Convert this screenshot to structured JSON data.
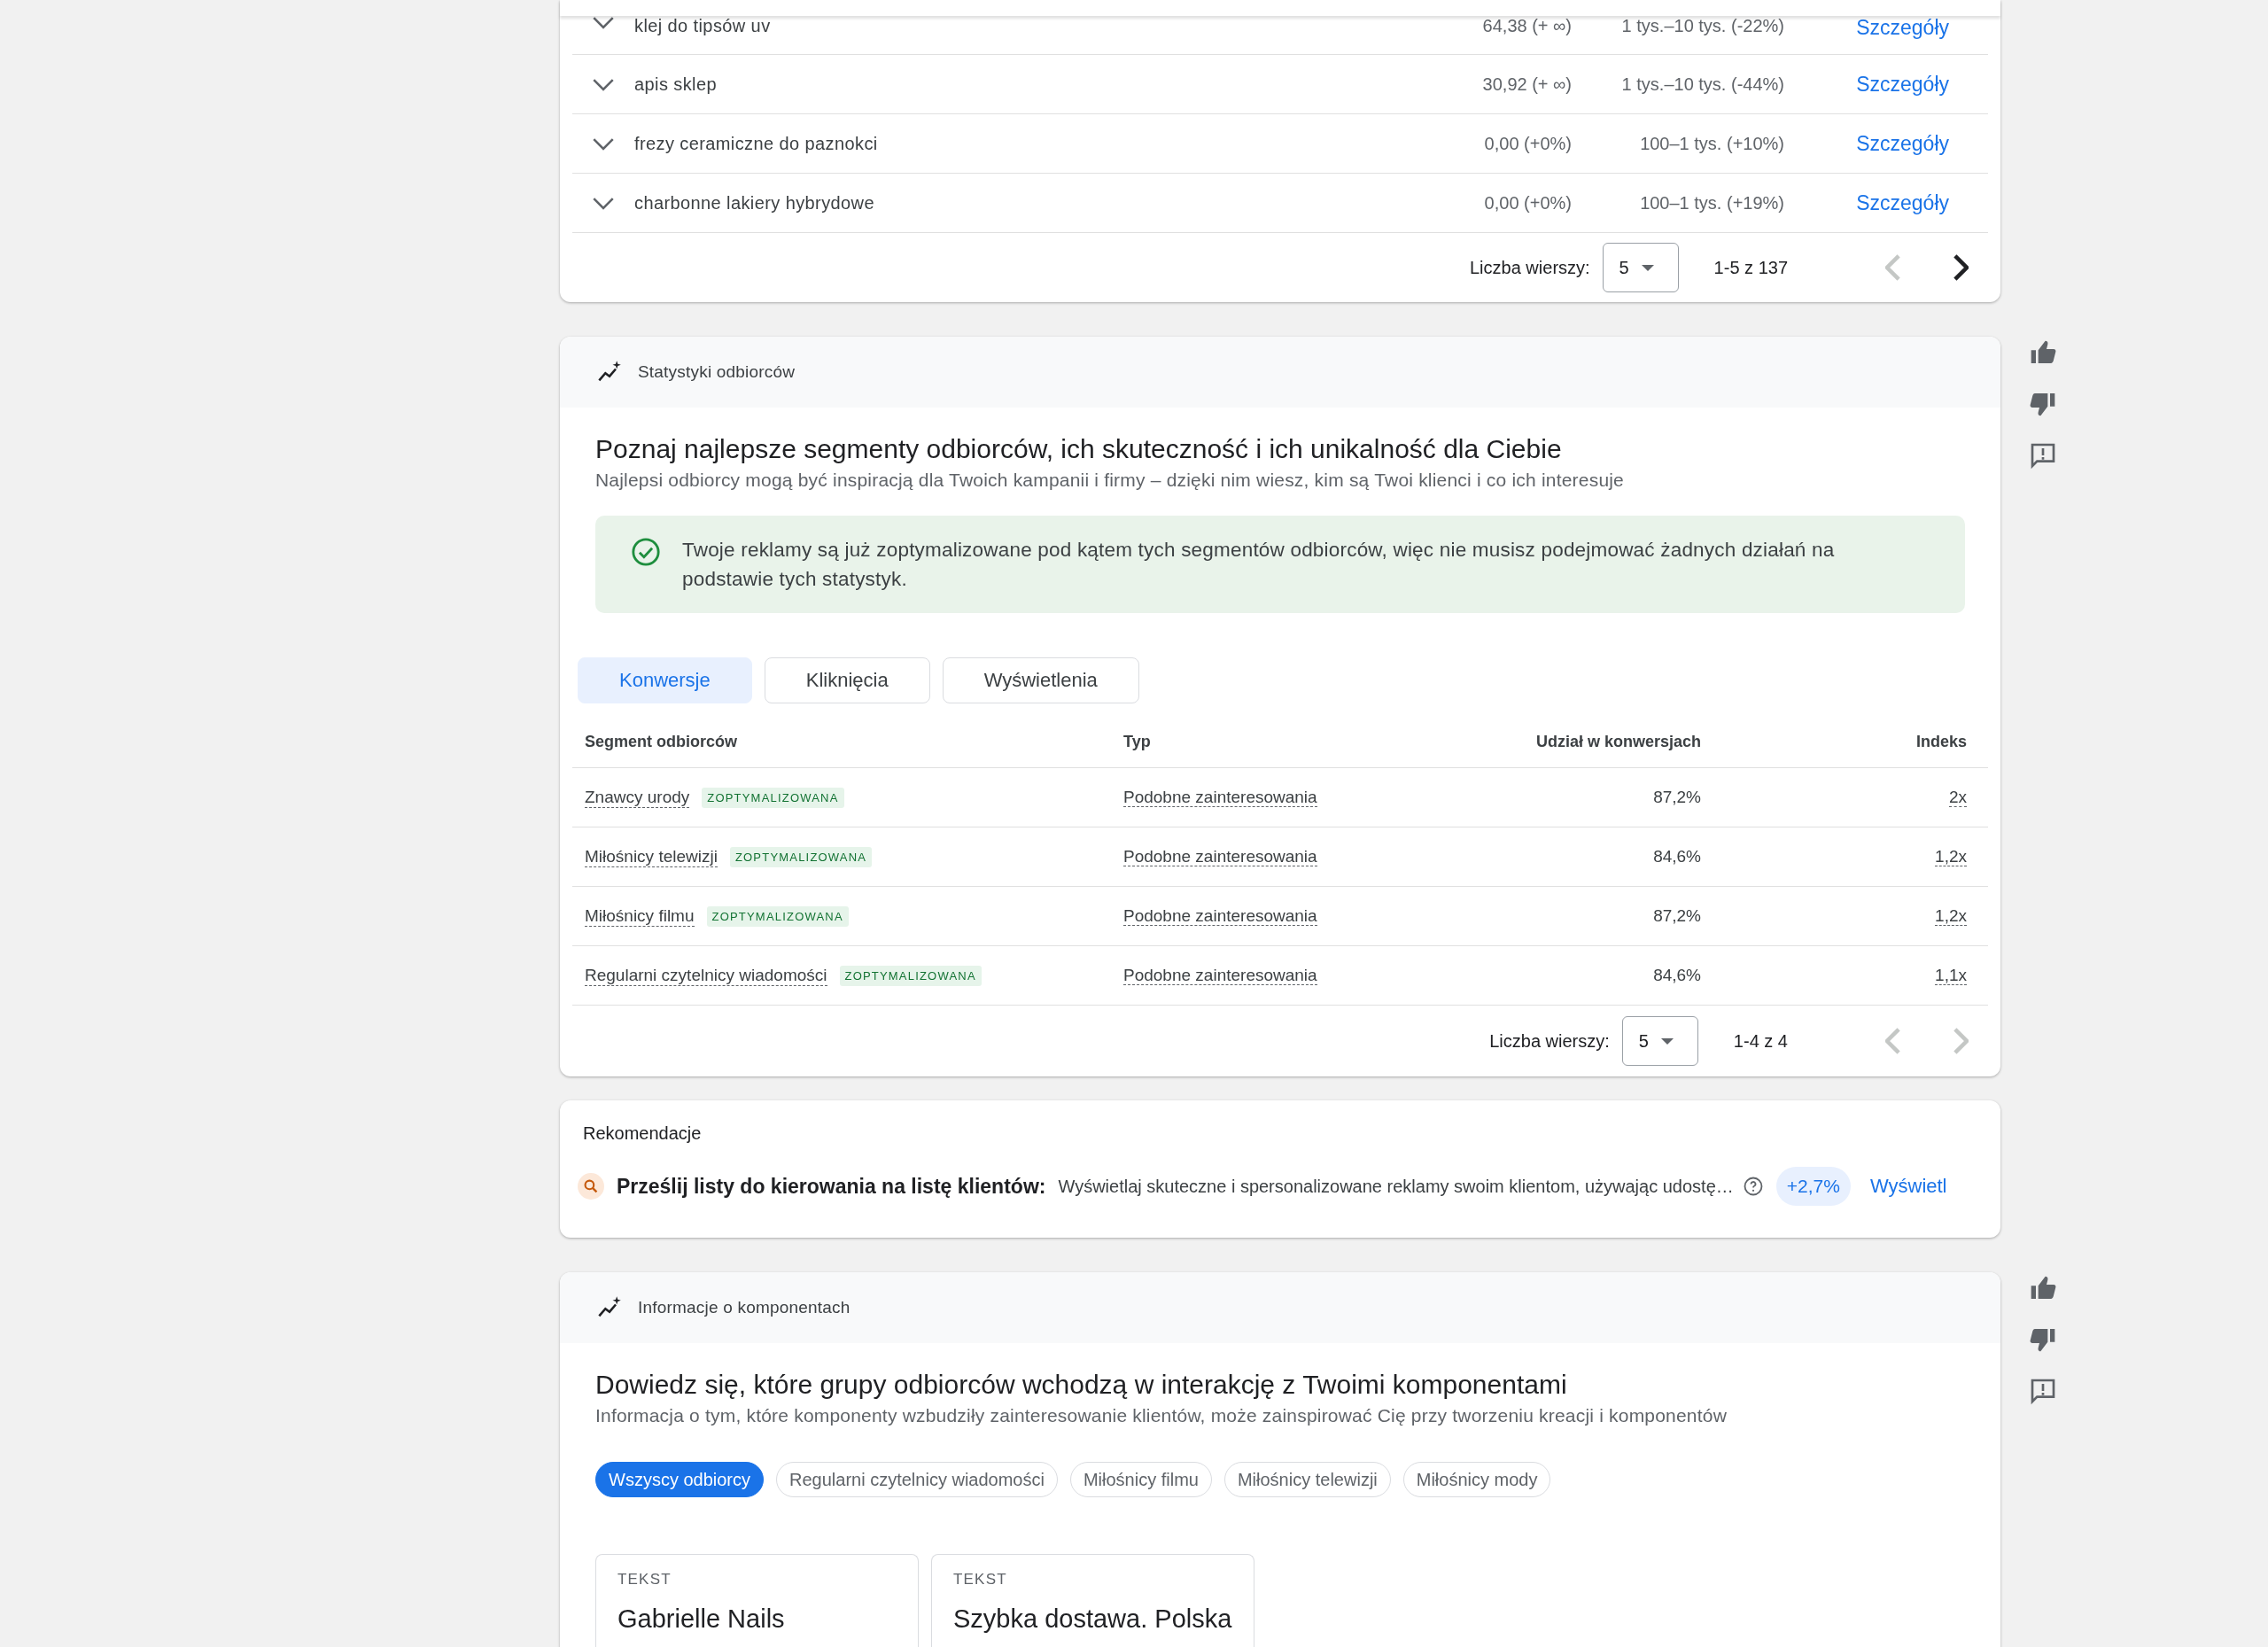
{
  "keyword_table": {
    "rows": [
      {
        "keyword": "klej do tipsów uv",
        "column_2": "64,38 (+ ∞)",
        "column_3": "1 tys.–10 tys. (-22%)",
        "link": "Szczegóły"
      },
      {
        "keyword": "apis sklep",
        "column_2": "30,92 (+ ∞)",
        "column_3": "1 tys.–10 tys. (-44%)",
        "link": "Szczegóły"
      },
      {
        "keyword": "frezy ceramiczne do paznokci",
        "column_2": "0,00 (+0%)",
        "column_3": "100–1 tys. (+10%)",
        "link": "Szczegóły"
      },
      {
        "keyword": "charbonne lakiery hybrydowe",
        "column_2": "0,00 (+0%)",
        "column_3": "100–1 tys. (+19%)",
        "link": "Szczegóły"
      }
    ],
    "pagination": {
      "rows_label": "Liczba wierszy:",
      "rows_value": "5",
      "range": "1-5 z 137",
      "prev_disabled": true,
      "next_disabled": false
    }
  },
  "audience_insights": {
    "header": "Statystyki odbiorców",
    "title": "Poznaj najlepsze segmenty odbiorców, ich skuteczność i ich unikalność dla Ciebie",
    "subtitle": "Najlepsi odbiorcy mogą być inspiracją dla Twoich kampanii i firmy – dzięki nim wiesz, kim są Twoi klienci i co ich interesuje",
    "notice": "Twoje reklamy są już zoptymalizowane pod kątem tych segmentów odbiorców, więc nie musisz podejmować żadnych działań na podstawie tych statystyk.",
    "tabs": [
      {
        "label": "Konwersje",
        "selected": true
      },
      {
        "label": "Kliknięcia",
        "selected": false
      },
      {
        "label": "Wyświetlenia",
        "selected": false
      }
    ],
    "table": {
      "columns": [
        "Segment odbiorców",
        "Typ",
        "Udział w konwersjach",
        "Indeks"
      ],
      "rows": [
        {
          "segment": "Znawcy urody",
          "badge": "ZOPTYMALIZOWANA",
          "type": "Podobne zainteresowania",
          "share": "87,2%",
          "index": "2x"
        },
        {
          "segment": "Miłośnicy telewizji",
          "badge": "ZOPTYMALIZOWANA",
          "type": "Podobne zainteresowania",
          "share": "84,6%",
          "index": "1,2x"
        },
        {
          "segment": "Miłośnicy filmu",
          "badge": "ZOPTYMALIZOWANA",
          "type": "Podobne zainteresowania",
          "share": "87,2%",
          "index": "1,2x"
        },
        {
          "segment": "Regularni czytelnicy wiadomości",
          "badge": "ZOPTYMALIZOWANA",
          "type": "Podobne zainteresowania",
          "share": "84,6%",
          "index": "1,1x"
        }
      ]
    },
    "pagination": {
      "rows_label": "Liczba wierszy:",
      "rows_value": "5",
      "range": "1-4 z 4",
      "prev_disabled": true,
      "next_disabled": true
    }
  },
  "recommendations": {
    "heading": "Rekomendacje",
    "items": [
      {
        "title": "Prześlij listy do kierowania na listę klientów:",
        "description": "Wyświetlaj skuteczne i spersonalizowane reklamy swoim klientom, używając udostę…",
        "uplift": "+2,7%",
        "action": "Wyświetl"
      }
    ]
  },
  "asset_insights": {
    "header": "Informacje o komponentach",
    "title": "Dowiedz się, które grupy odbiorców wchodzą w interakcję z Twoimi komponentami",
    "subtitle": "Informacja o tym, które komponenty wzbudziły zainteresowanie klientów, może zainspirować Cię przy tworzeniu kreacji i komponentów",
    "chips": [
      {
        "label": "Wszyscy odbiorcy",
        "selected": true
      },
      {
        "label": "Regularni czytelnicy wiadomości",
        "selected": false
      },
      {
        "label": "Miłośnicy filmu",
        "selected": false
      },
      {
        "label": "Miłośnicy telewizji",
        "selected": false
      },
      {
        "label": "Miłośnicy mody",
        "selected": false
      }
    ],
    "cards": [
      {
        "label": "TEKST",
        "text": "Gabrielle Nails"
      },
      {
        "label": "TEKST",
        "text": "Szybka dostawa. Polska"
      }
    ]
  }
}
